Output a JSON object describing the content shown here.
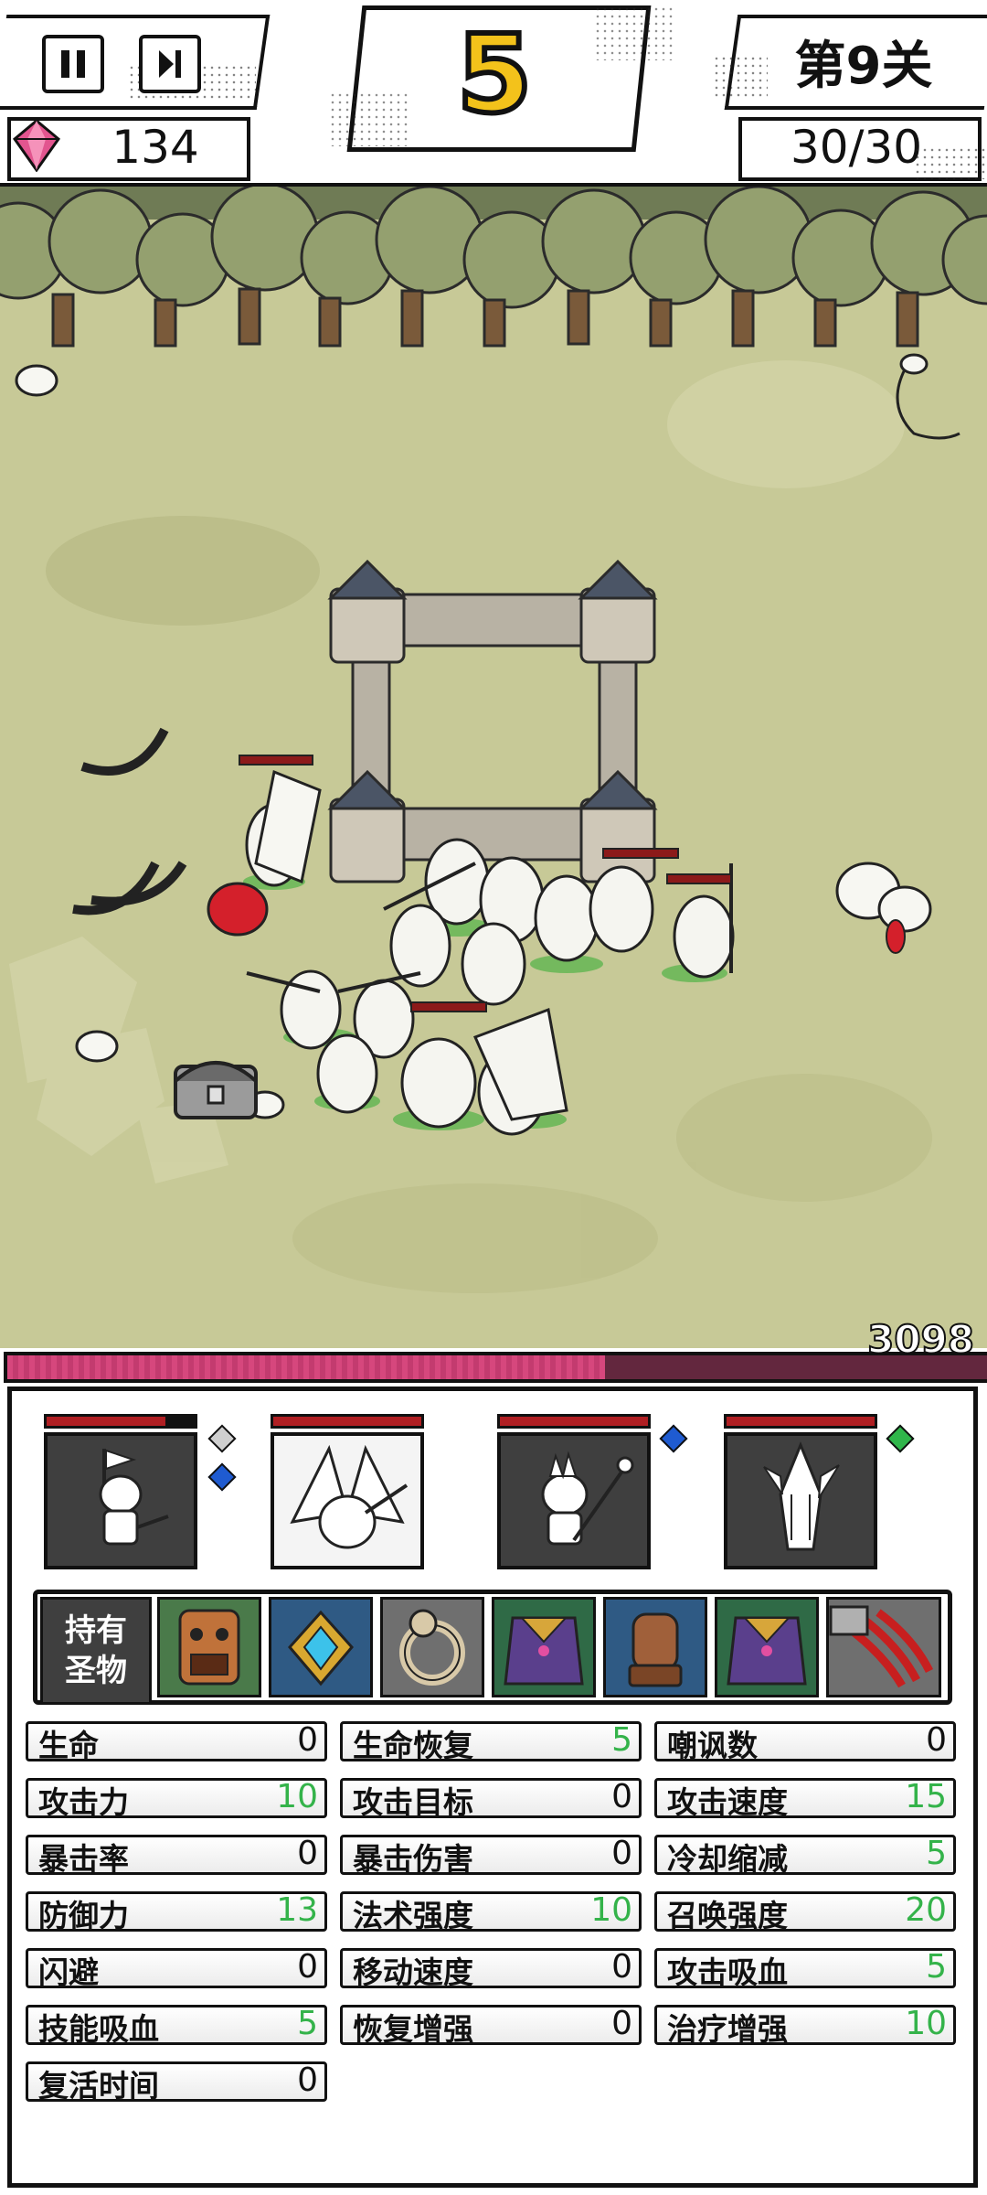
{
  "hud": {
    "wave": "5",
    "level": "第9关",
    "gems": "134",
    "kills": "30/30"
  },
  "boss": {
    "hp_value": "3098",
    "hp_fraction": 0.61
  },
  "units": [
    {
      "name": "knight",
      "hp_fraction": 0.8,
      "pips": [
        "gray",
        "blue"
      ]
    },
    {
      "name": "dragon-knight",
      "hp_fraction": 1.0,
      "pips": []
    },
    {
      "name": "spear-mage",
      "hp_fraction": 1.0,
      "pips": [
        "blue"
      ]
    },
    {
      "name": "spike-warrior",
      "hp_fraction": 1.0,
      "pips": [
        "green"
      ]
    }
  ],
  "relics": {
    "label": "持有圣物",
    "items": [
      "tiki-mask",
      "blue-gem-amulet",
      "skull-ring",
      "purple-cape",
      "wooden-gauntlet",
      "purple-cape",
      "red-claw"
    ]
  },
  "stats": [
    {
      "name": "生命",
      "value": "0",
      "highlight": false
    },
    {
      "name": "生命恢复",
      "value": "5",
      "highlight": true
    },
    {
      "name": "嘲讽数",
      "value": "0",
      "highlight": false
    },
    {
      "name": "攻击力",
      "value": "10",
      "highlight": true
    },
    {
      "name": "攻击目标",
      "value": "0",
      "highlight": false
    },
    {
      "name": "攻击速度",
      "value": "15",
      "highlight": true
    },
    {
      "name": "暴击率",
      "value": "0",
      "highlight": false
    },
    {
      "name": "暴击伤害",
      "value": "0",
      "highlight": false
    },
    {
      "name": "冷却缩减",
      "value": "5",
      "highlight": true
    },
    {
      "name": "防御力",
      "value": "13",
      "highlight": true
    },
    {
      "name": "法术强度",
      "value": "10",
      "highlight": true
    },
    {
      "name": "召唤强度",
      "value": "20",
      "highlight": true
    },
    {
      "name": "闪避",
      "value": "0",
      "highlight": false
    },
    {
      "name": "移动速度",
      "value": "0",
      "highlight": false
    },
    {
      "name": "攻击吸血",
      "value": "5",
      "highlight": true
    },
    {
      "name": "技能吸血",
      "value": "5",
      "highlight": true
    },
    {
      "name": "恢复增强",
      "value": "0",
      "highlight": false
    },
    {
      "name": "治疗增强",
      "value": "10",
      "highlight": true
    },
    {
      "name": "复活时间",
      "value": "0",
      "highlight": false
    }
  ],
  "colors": {
    "positive": "#34b34a",
    "boss_bar": "#d6477d",
    "hp_bar": "#b01f23",
    "wave_digit": "#f3c21b"
  }
}
